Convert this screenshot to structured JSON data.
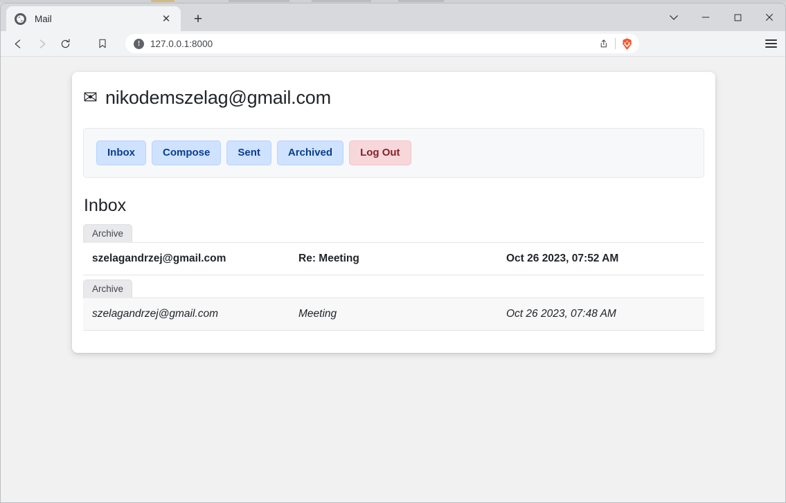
{
  "browser": {
    "tab": {
      "title": "Mail",
      "favicon": "globe-icon",
      "close": "✕"
    },
    "newtab_label": "+",
    "window_controls": {
      "tab_search": "tab-search-chevron-icon",
      "minimize": "minimize-icon",
      "maximize": "maximize-icon",
      "close": "close-icon"
    },
    "toolbar": {
      "back": "back-arrow-icon",
      "forward": "forward-arrow-icon",
      "reload": "reload-icon",
      "bookmark": "bookmark-icon",
      "url": "127.0.0.1:8000",
      "url_placeholder": "Search or enter address",
      "security_icon": "not-secure-info-icon",
      "security_glyph": "!",
      "share": "share-icon",
      "shields": "brave-shields-lion-icon",
      "menu": "hamburger-menu-icon"
    }
  },
  "page": {
    "user_email": "nikodemszelag@gmail.com",
    "envelope_icon": "✉",
    "nav": {
      "items": [
        {
          "label": "Inbox",
          "style": "primary"
        },
        {
          "label": "Compose",
          "style": "primary"
        },
        {
          "label": "Sent",
          "style": "primary"
        },
        {
          "label": "Archived",
          "style": "primary"
        },
        {
          "label": "Log Out",
          "style": "danger"
        }
      ]
    },
    "mailbox_title": "Inbox",
    "archive_label": "Archive",
    "emails": [
      {
        "sender": "szelagandrzej@gmail.com",
        "subject": "Re: Meeting",
        "timestamp": "Oct 26 2023, 07:52 AM",
        "read": false
      },
      {
        "sender": "szelagandrzej@gmail.com",
        "subject": "Meeting",
        "timestamp": "Oct 26 2023, 07:48 AM",
        "read": true
      }
    ]
  },
  "colors": {
    "accent_blue_bg": "#cfe2ff",
    "accent_blue_text": "#0a3d8f",
    "danger_bg": "#f8d7da",
    "danger_text": "#842029",
    "brave_orange": "#fb542b",
    "page_bg": "#f1f1f1",
    "card_bg": "#ffffff",
    "read_row_bg": "#f8f8f9"
  }
}
